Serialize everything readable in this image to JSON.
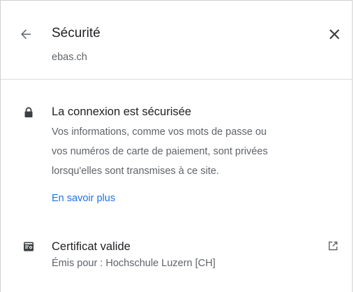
{
  "header": {
    "title": "Sécurité",
    "subtitle": "ebas.ch",
    "back_icon": "arrow-back-icon",
    "close_icon": "close-icon"
  },
  "connection": {
    "icon": "lock-icon",
    "title": "La connexion est sécurisée",
    "lines": [
      "Vos informations, comme vos mots de passe ou",
      "vos numéros de carte de paiement, sont privées",
      "lorsqu'elles sont transmises à ce site."
    ],
    "learn_more": "En savoir plus"
  },
  "certificate": {
    "icon": "certificate-icon",
    "title": "Certificat valide",
    "issued_for": "Émis pour : Hochschule Luzern [CH]",
    "open_icon": "external-link-icon"
  },
  "colors": {
    "text_primary": "#202124",
    "text_secondary": "#5f6368",
    "link": "#1a73e8",
    "icon": "#5f6368"
  }
}
